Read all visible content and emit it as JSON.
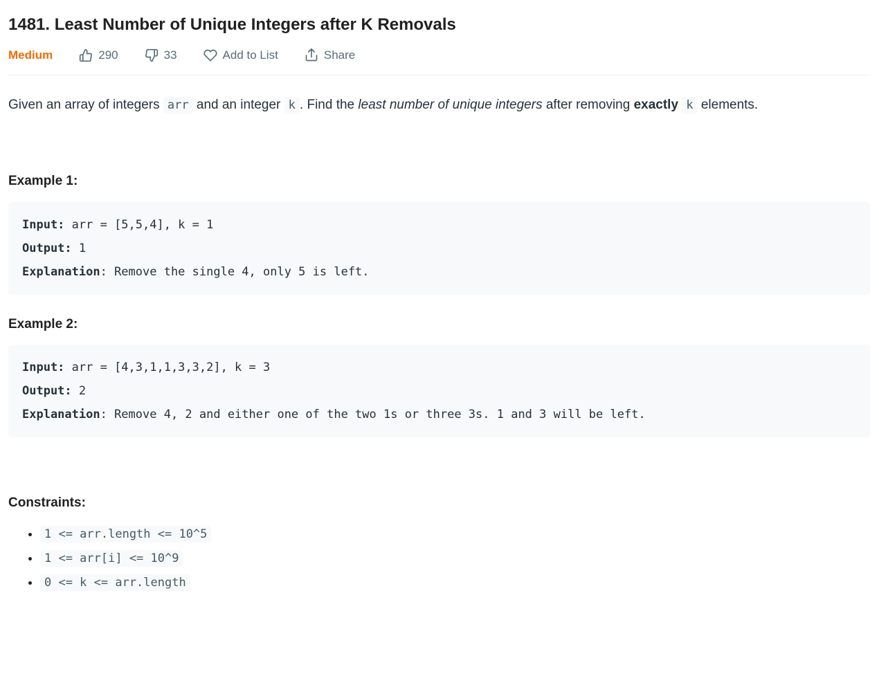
{
  "title": "1481. Least Number of Unique Integers after K Removals",
  "meta": {
    "difficulty": "Medium",
    "likes": "290",
    "dislikes": "33",
    "add_to_list": "Add to List",
    "share": "Share"
  },
  "description": {
    "pre1": "Given an array of integers ",
    "code1": "arr",
    "mid1": " and an integer ",
    "code2": "k",
    "mid2": ". Find the ",
    "em": "least number of unique integers",
    "post_em": " after removing ",
    "strong": "exactly",
    "post_strong_pre_code": " ",
    "code3": "k",
    "tail": " elements."
  },
  "example1": {
    "heading": "Example 1:",
    "input_label": "Input:",
    "input_value": " arr = [5,5,4], k = 1",
    "output_label": "Output:",
    "output_value": " 1",
    "explanation_label": "Explanation",
    "explanation_value": ": Remove the single 4, only 5 is left."
  },
  "example2": {
    "heading": "Example 2:",
    "input_label": "Input:",
    "input_value": " arr = [4,3,1,1,3,3,2], k = 3",
    "output_label": "Output:",
    "output_value": " 2",
    "explanation_label": "Explanation",
    "explanation_value": ": Remove 4, 2 and either one of the two 1s or three 3s. 1 and 3 will be left."
  },
  "constraints": {
    "heading": "Constraints:",
    "items": [
      "1 <= arr.length <= 10^5",
      "1 <= arr[i] <= 10^9",
      "0 <= k <= arr.length"
    ]
  }
}
